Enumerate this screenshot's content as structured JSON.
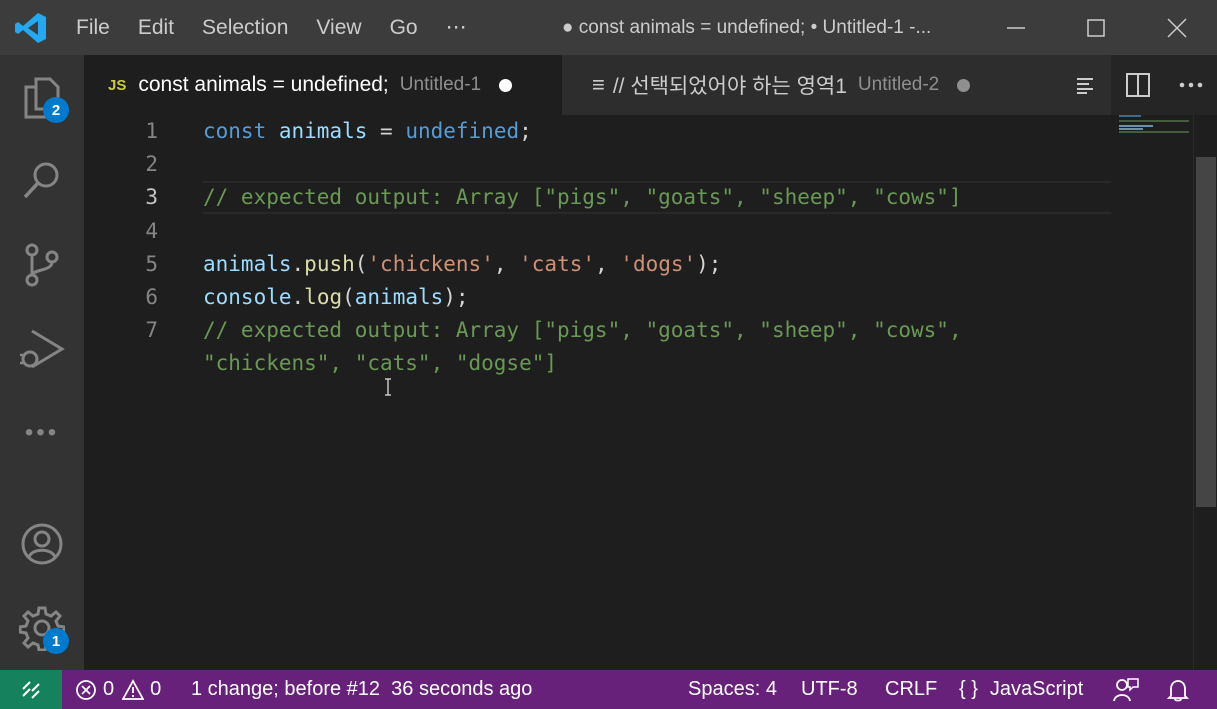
{
  "window": {
    "menu": [
      "File",
      "Edit",
      "Selection",
      "View",
      "Go",
      "⋯"
    ],
    "title": "● const animals = undefined; • Untitled-1 -..."
  },
  "activity_bar": {
    "explorer_badge": "2",
    "settings_badge": "1",
    "more": "•••"
  },
  "tabs": [
    {
      "icon_text": "JS",
      "title": "const animals = undefined;",
      "description": "Untitled-1",
      "dirty": true,
      "active": true
    },
    {
      "icon_text": "≡",
      "title": "// 선택되었어야 하는 영역1",
      "description": "Untitled-2",
      "dirty": true,
      "active": false
    }
  ],
  "editor": {
    "line_numbers": [
      "1",
      "2",
      "3",
      "4",
      "5",
      "6",
      "7"
    ],
    "current_line": 3,
    "lines": [
      [
        {
          "t": "kw",
          "v": "const"
        },
        {
          "t": "punc",
          "v": " "
        },
        {
          "t": "var",
          "v": "animals"
        },
        {
          "t": "punc",
          "v": " = "
        },
        {
          "t": "kw",
          "v": "undefined"
        },
        {
          "t": "punc",
          "v": ";"
        }
      ],
      [],
      [
        {
          "t": "cmt",
          "v": "// expected output: Array [\"pigs\", \"goats\", \"sheep\", \"cows\"]"
        }
      ],
      [],
      [
        {
          "t": "var",
          "v": "animals"
        },
        {
          "t": "punc",
          "v": "."
        },
        {
          "t": "fn",
          "v": "push"
        },
        {
          "t": "punc",
          "v": "("
        },
        {
          "t": "str",
          "v": "'chickens'"
        },
        {
          "t": "punc",
          "v": ", "
        },
        {
          "t": "str",
          "v": "'cats'"
        },
        {
          "t": "punc",
          "v": ", "
        },
        {
          "t": "str",
          "v": "'dogs'"
        },
        {
          "t": "punc",
          "v": ");"
        }
      ],
      [
        {
          "t": "var",
          "v": "console"
        },
        {
          "t": "punc",
          "v": "."
        },
        {
          "t": "fn",
          "v": "log"
        },
        {
          "t": "punc",
          "v": "("
        },
        {
          "t": "var",
          "v": "animals"
        },
        {
          "t": "punc",
          "v": ");"
        }
      ],
      [
        {
          "t": "cmt",
          "v": "// expected output: Array [\"pigs\", \"goats\", \"sheep\", \"cows\","
        }
      ],
      [
        {
          "t": "cmt",
          "v": "\"chickens\", \"cats\", \"dogse\"]"
        }
      ]
    ]
  },
  "status_bar": {
    "errors": "0",
    "warnings": "0",
    "change_info": "1 change; before #12  36 seconds ago",
    "indent": "Spaces: 4",
    "encoding": "UTF-8",
    "eol": "CRLF",
    "language_icon": "{ }",
    "language": "JavaScript"
  },
  "colors": {
    "status_bar_bg": "#68217a",
    "remote_bg": "#16825d",
    "badge_bg": "#007acc",
    "accent": "#007acc"
  }
}
